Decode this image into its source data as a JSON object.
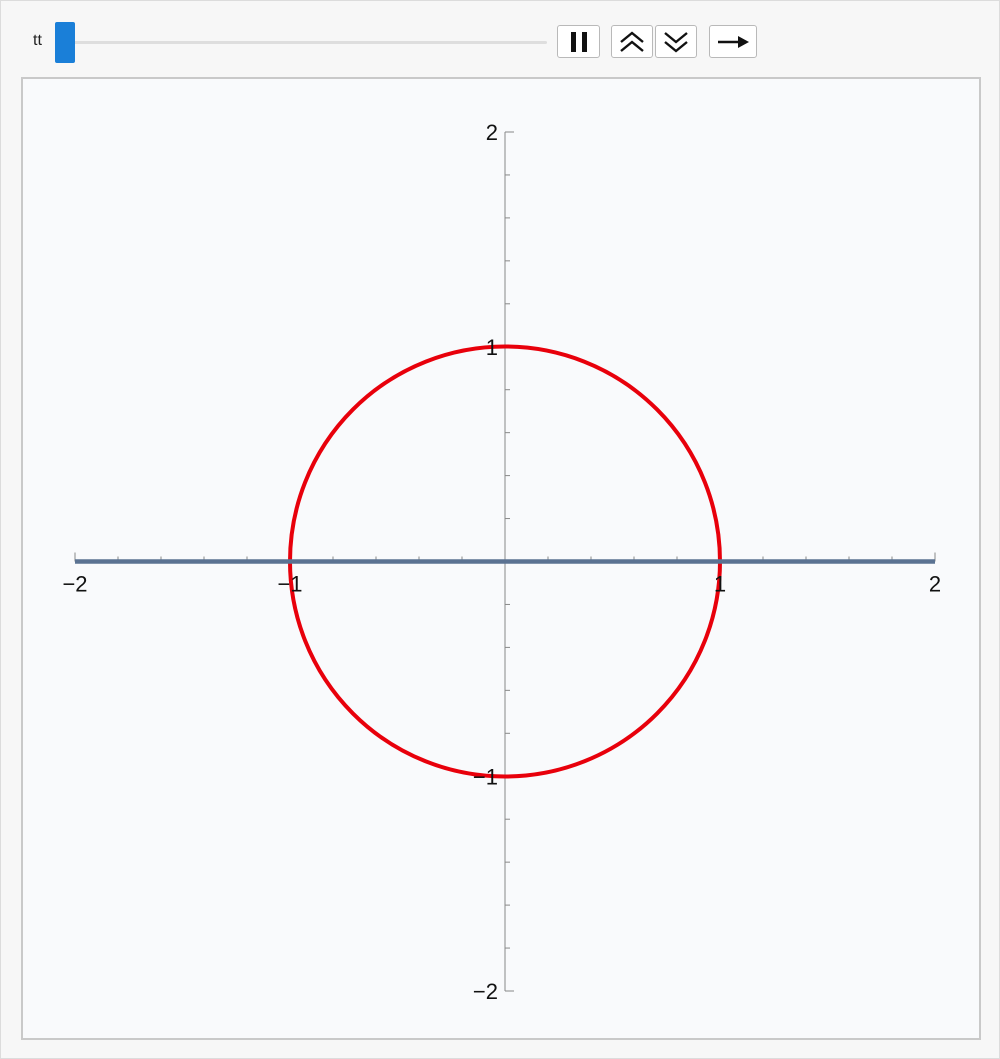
{
  "control": {
    "variable_label": "tt",
    "slider_value_fraction": 0.0
  },
  "buttons": {
    "pause": {
      "icon": "pause-icon"
    },
    "faster": {
      "icon": "double-chevron-up-icon"
    },
    "slower": {
      "icon": "double-chevron-down-icon"
    },
    "direction": {
      "icon": "arrow-right-icon"
    }
  },
  "chart_data": {
    "type": "line",
    "xlim": [
      -2,
      2
    ],
    "ylim": [
      -2,
      2
    ],
    "x_ticks": [
      {
        "value": -2,
        "label": "−2"
      },
      {
        "value": -1,
        "label": "−1"
      },
      {
        "value": 1,
        "label": "1"
      },
      {
        "value": 2,
        "label": "2"
      }
    ],
    "y_ticks": [
      {
        "value": 2,
        "label": "2"
      },
      {
        "value": 1,
        "label": "1"
      },
      {
        "value": -1,
        "label": "−1"
      },
      {
        "value": -2,
        "label": "−2"
      }
    ],
    "minor_tick_step": 0.2,
    "grid": false,
    "series": [
      {
        "shape": "circle",
        "center": [
          0,
          0
        ],
        "radius": 1,
        "color": "#e8000b"
      },
      {
        "shape": "segment",
        "from": [
          -2,
          0
        ],
        "to": [
          2,
          0
        ],
        "color": "#5b7292"
      }
    ],
    "axis_color": "#888888"
  }
}
